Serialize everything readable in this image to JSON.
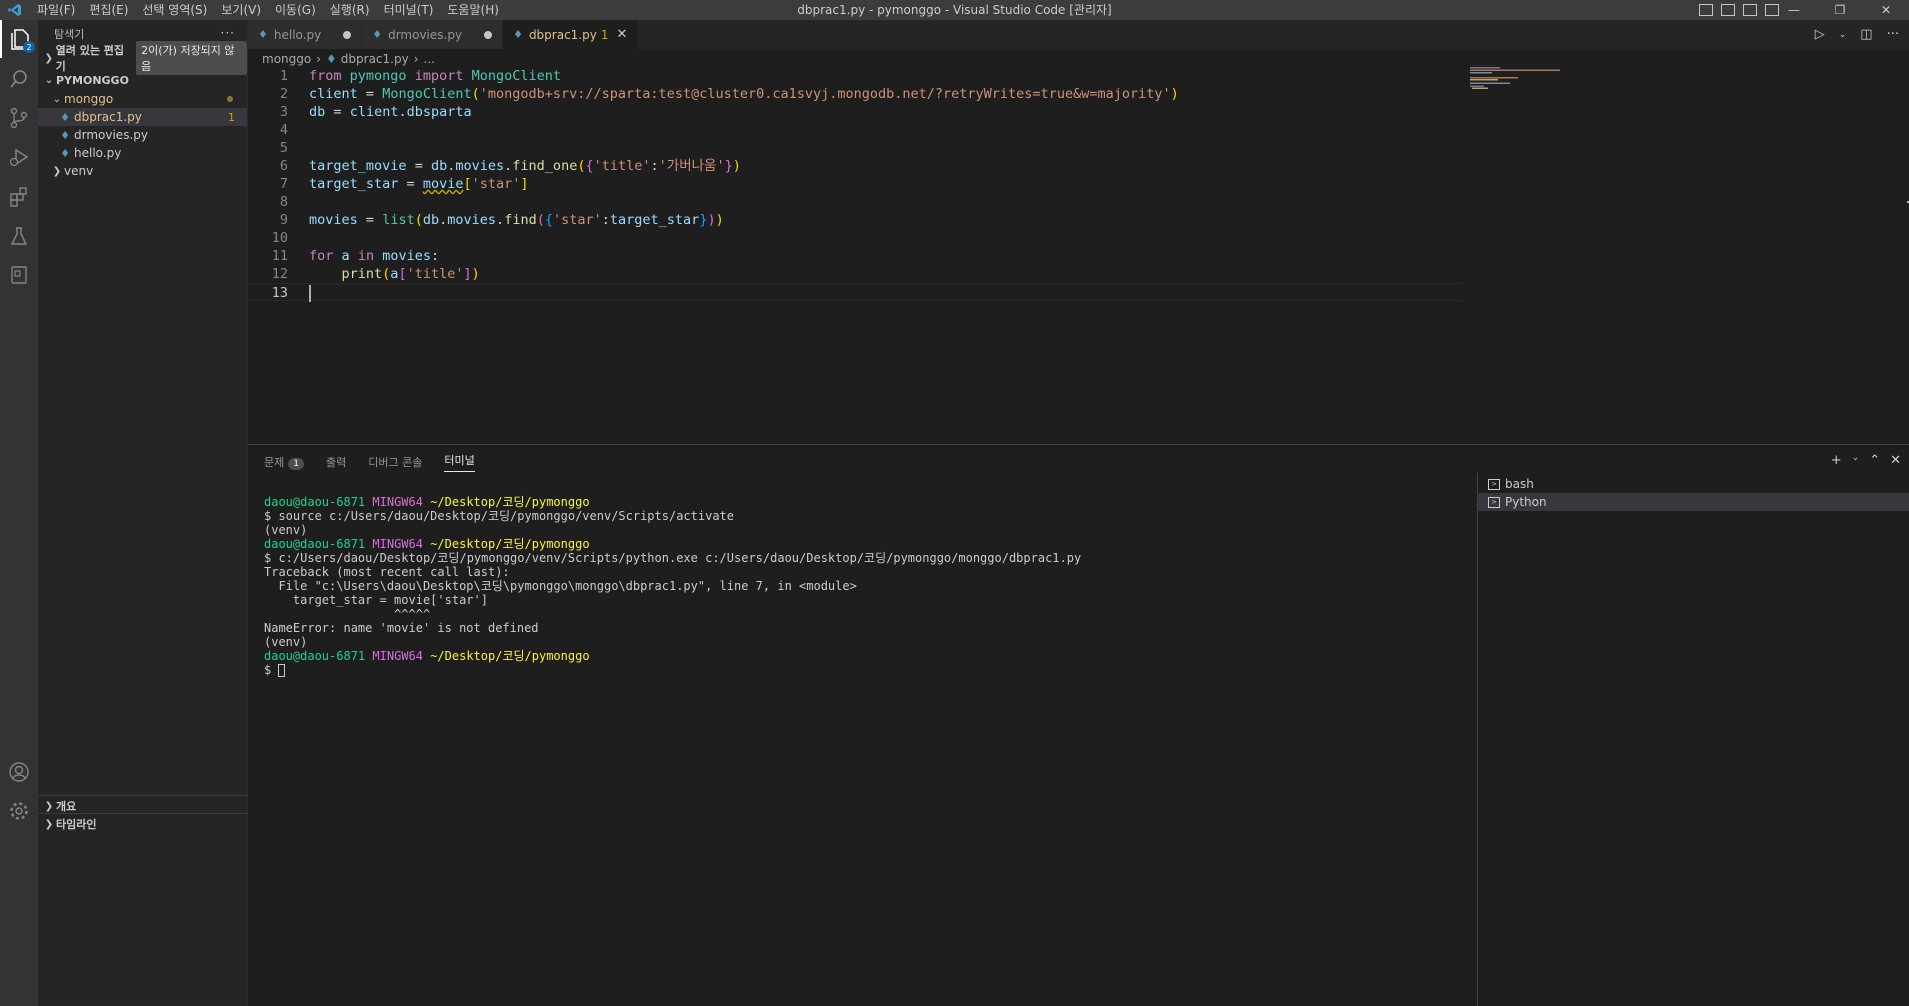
{
  "window": {
    "title": "dbprac1.py - pymonggo - Visual Studio Code [관리자]",
    "menu": [
      "파일(F)",
      "편집(E)",
      "선택 영역(S)",
      "보기(V)",
      "이동(G)",
      "실행(R)",
      "터미널(T)",
      "도움말(H)"
    ]
  },
  "activity": {
    "explorer_badge": "2"
  },
  "sidebar": {
    "title": "탐색기",
    "open_editors": "열려 있는 편집기",
    "unsaved": "2이(가) 저장되지 않음",
    "project": "PYMONGGO",
    "folder": "monggo",
    "files": [
      {
        "name": "dbprac1.py",
        "problems": "1"
      },
      {
        "name": "drmovies.py"
      },
      {
        "name": "hello.py"
      }
    ],
    "venv": "venv",
    "outline": "개요",
    "timeline": "타임라인"
  },
  "tabs": [
    {
      "label": "hello.py"
    },
    {
      "label": "drmovies.py"
    },
    {
      "label": "dbprac1.py",
      "problems": "1"
    }
  ],
  "breadcrumb": [
    "monggo",
    "dbprac1.py",
    "..."
  ],
  "editor": {
    "line_numbers": [
      "1",
      "2",
      "3",
      "4",
      "5",
      "6",
      "7",
      "8",
      "9",
      "10",
      "11",
      "12",
      "13"
    ]
  },
  "panel": {
    "tabs": [
      "문제",
      "출력",
      "디버그 콘솔",
      "터미널"
    ],
    "problems_count": "1",
    "terminals": [
      "bash",
      "Python"
    ],
    "terminal": {
      "prompt_user": "daou@daou-6871",
      "prompt_sys": "MINGW64",
      "prompt_path": "~/Desktop/코딩/pymonggo",
      "cmd1": "$ source c:/Users/daou/Desktop/코딩/pymonggo/venv/Scripts/activate",
      "venv": "(venv)",
      "cmd2": "$ c:/Users/daou/Desktop/코딩/pymonggo/venv/Scripts/python.exe c:/Users/daou/Desktop/코딩/pymonggo/monggo/dbprac1.py",
      "tb1": "Traceback (most recent call last):",
      "tb2": "  File \"c:\\Users\\daou\\Desktop\\코딩\\pymonggo\\monggo\\dbprac1.py\", line 7, in <module>",
      "tb3": "    target_star = movie['star']",
      "tb4": "                  ^^^^^",
      "err": "NameError: name 'movie' is not defined",
      "final_prompt": "$ "
    }
  }
}
